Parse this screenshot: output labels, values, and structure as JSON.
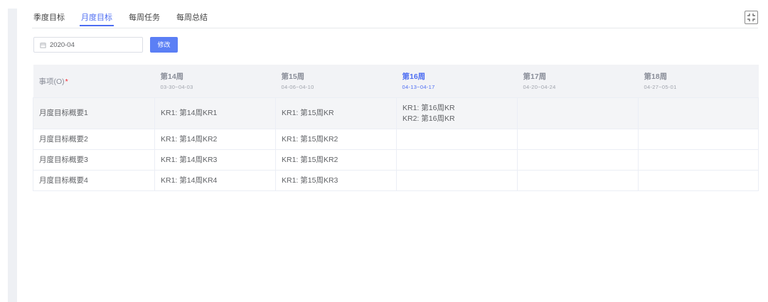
{
  "colors": {
    "accent": "#4e6ef2",
    "button": "#5b7ff5",
    "required": "#f5222d"
  },
  "icons": {
    "calendar": "calendar-icon",
    "exit_fullscreen": "fullscreen-exit-icon"
  },
  "tabs": [
    {
      "label": "季度目标",
      "active": false
    },
    {
      "label": "月度目标",
      "active": true
    },
    {
      "label": "每周任务",
      "active": false
    },
    {
      "label": "每周总结",
      "active": false
    }
  ],
  "toolbar": {
    "month_value": "2020-04",
    "edit_label": "修改"
  },
  "table": {
    "item_header": "事项(O)",
    "required_mark": "*",
    "weeks": [
      {
        "label": "第14周",
        "range": "03-30~04-03",
        "current": false
      },
      {
        "label": "第15周",
        "range": "04-06~04-10",
        "current": false
      },
      {
        "label": "第16周",
        "range": "04-13~04-17",
        "current": true
      },
      {
        "label": "第17周",
        "range": "04-20~04-24",
        "current": false
      },
      {
        "label": "第18周",
        "range": "04-27~05-01",
        "current": false
      }
    ],
    "rows": [
      {
        "item": "月度目标概要1",
        "cells": [
          [
            "KR1: 第14周KR1"
          ],
          [
            "KR1: 第15周KR"
          ],
          [
            "KR1: 第16周KR",
            "KR2: 第16周KR"
          ],
          [],
          []
        ]
      },
      {
        "item": "月度目标概要2",
        "cells": [
          [
            "KR1: 第14周KR2"
          ],
          [
            "KR1: 第15周KR2"
          ],
          [],
          [],
          []
        ]
      },
      {
        "item": "月度目标概要3",
        "cells": [
          [
            "KR1: 第14周KR3"
          ],
          [
            "KR1: 第15周KR2"
          ],
          [],
          [],
          []
        ]
      },
      {
        "item": "月度目标概要4",
        "cells": [
          [
            "KR1: 第14周KR4"
          ],
          [
            "KR1: 第15周KR3"
          ],
          [],
          [],
          []
        ]
      }
    ]
  }
}
